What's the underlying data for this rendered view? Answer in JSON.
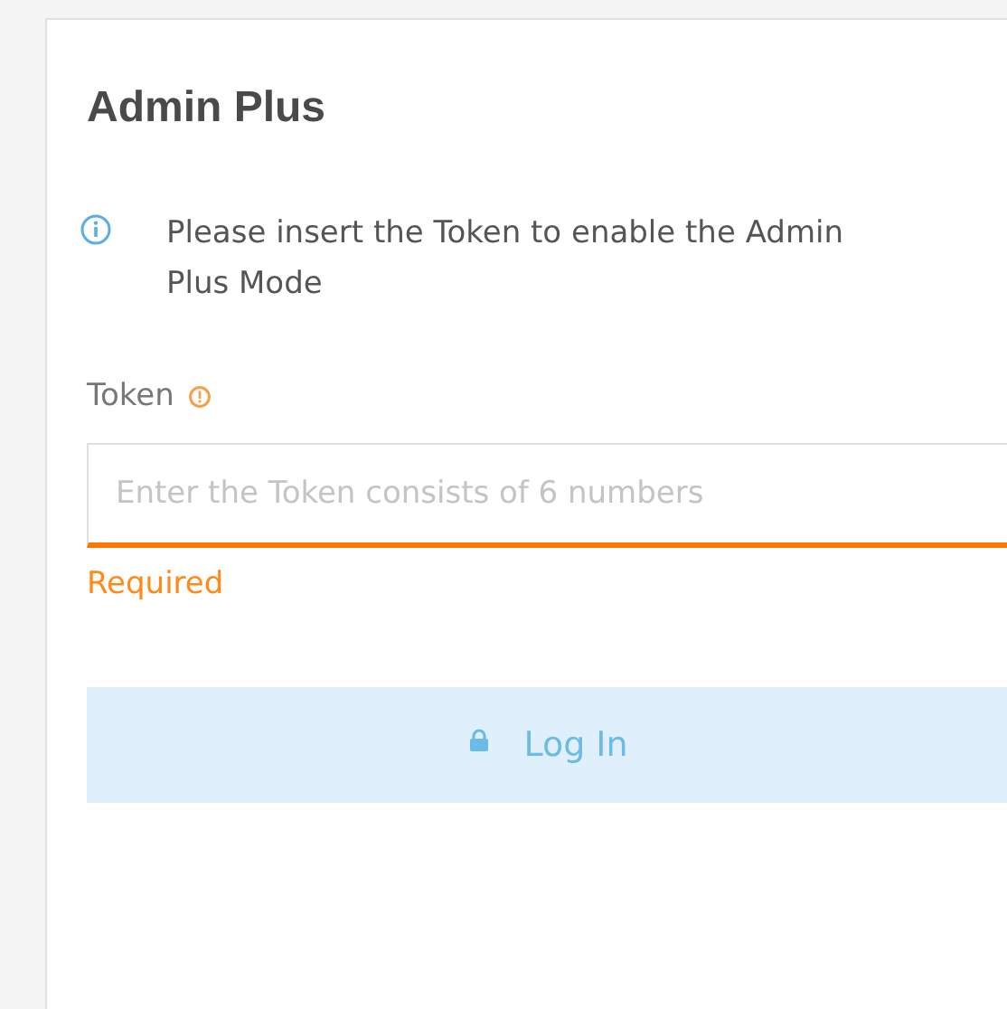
{
  "dialog": {
    "title": "Admin Plus",
    "info": "Please insert the Token to enable the Admin Plus Mode",
    "token_field": {
      "label": "Token",
      "required": true,
      "placeholder": "Enter the Token consists of 6 numbers",
      "invalid": true,
      "error": "Required"
    },
    "login_button": {
      "label": "Log In",
      "disabled": true
    }
  }
}
